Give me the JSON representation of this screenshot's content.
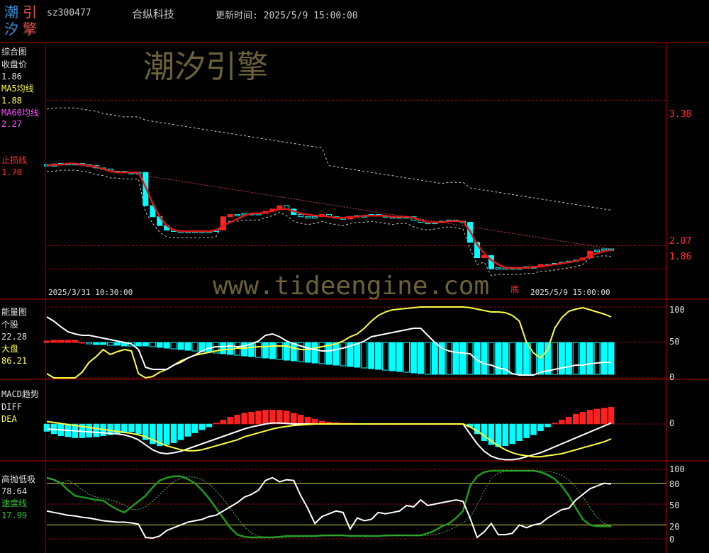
{
  "header": {
    "logo_chars": [
      "潮",
      "引",
      "汐",
      "擎"
    ],
    "code": "sz300477",
    "name": "合纵科技",
    "update_label": "更新时间: 2025/5/9 15:00:00"
  },
  "watermark": {
    "brand": "潮汐引擎",
    "url": "www.tideengine.com"
  },
  "panel1": {
    "title": "综合图",
    "close_label": "收盘价",
    "close_value": "1.86",
    "ma5_label": "MA5均线",
    "ma5_value": "1.88",
    "ma60_label": "MA60均线",
    "ma60_value": "2.27",
    "stop_label": "止损线",
    "stop_value": "1.70",
    "right_ticks": [
      "3.38",
      "2.07",
      "1.86"
    ],
    "date_start": "2025/3/31 10:30:00",
    "date_end": "2025/5/9 15:00:00",
    "marker_di": "底"
  },
  "panel2": {
    "title": "能量图",
    "stock_label": "个股",
    "stock_value": "22.28",
    "market_label": "大盘",
    "market_value": "86.21",
    "ticks": [
      "100",
      "50",
      "0"
    ]
  },
  "panel3": {
    "title": "MACD趋势",
    "diff_label": "DIFF",
    "dea_label": "DEA",
    "ticks": [
      "0"
    ]
  },
  "panel4": {
    "title": "高抛低吸",
    "value1": "78.64",
    "speed_label": "速度线",
    "speed_value": "17.99",
    "ticks": [
      "100",
      "80",
      "50",
      "20",
      "0"
    ]
  },
  "colors": {
    "up": "#ff2020",
    "down": "#00ffff",
    "ma5": "#ffff40",
    "ma60": "#e8e8e8",
    "red_line": "#e01818",
    "grid": "#b00000"
  },
  "chart_data": [
    {
      "type": "candlestick",
      "title": "综合图",
      "x_range": [
        "2025/3/31 10:30:00",
        "2025/5/9 15:00:00"
      ],
      "ylim": [
        1.6,
        3.9
      ],
      "ref_levels": [
        3.38,
        2.07,
        1.86
      ],
      "close": [
        2.8,
        2.8,
        2.81,
        2.81,
        2.81,
        2.8,
        2.79,
        2.77,
        2.76,
        2.74,
        2.74,
        2.73,
        2.73,
        2.73,
        2.43,
        2.33,
        2.25,
        2.21,
        2.2,
        2.2,
        2.2,
        2.2,
        2.2,
        2.2,
        2.21,
        2.33,
        2.35,
        2.35,
        2.36,
        2.36,
        2.36,
        2.38,
        2.4,
        2.43,
        2.4,
        2.35,
        2.33,
        2.32,
        2.33,
        2.35,
        2.33,
        2.32,
        2.31,
        2.33,
        2.34,
        2.34,
        2.35,
        2.34,
        2.33,
        2.32,
        2.33,
        2.33,
        2.3,
        2.28,
        2.27,
        2.28,
        2.29,
        2.3,
        2.29,
        2.28,
        2.1,
        1.96,
        1.98,
        1.86,
        1.87,
        1.87,
        1.87,
        1.87,
        1.88,
        1.88,
        1.9,
        1.9,
        1.91,
        1.92,
        1.93,
        1.94,
        1.96,
        2.02,
        2.03,
        2.04,
        2.03
      ],
      "series": [
        {
          "name": "MA5均线",
          "values": [
            2.79,
            2.8,
            2.8,
            2.81,
            2.81,
            2.8,
            2.79,
            2.78,
            2.76,
            2.74,
            2.73,
            2.73,
            2.73,
            2.73,
            2.6,
            2.45,
            2.33,
            2.25,
            2.21,
            2.2,
            2.2,
            2.2,
            2.2,
            2.2,
            2.21,
            2.25,
            2.28,
            2.31,
            2.34,
            2.36,
            2.36,
            2.37,
            2.38,
            2.4,
            2.4,
            2.38,
            2.36,
            2.35,
            2.34,
            2.34,
            2.33,
            2.32,
            2.32,
            2.33,
            2.33,
            2.34,
            2.34,
            2.34,
            2.34,
            2.33,
            2.33,
            2.33,
            2.32,
            2.3,
            2.28,
            2.28,
            2.28,
            2.29,
            2.29,
            2.29,
            2.2,
            2.08,
            2.0,
            1.94,
            1.9,
            1.87,
            1.87,
            1.87,
            1.87,
            1.88,
            1.88,
            1.89,
            1.9,
            1.91,
            1.92,
            1.93,
            1.95,
            1.98,
            2.0,
            2.02,
            2.03
          ]
        },
        {
          "name": "MA60均线",
          "values": [
            2.8,
            2.81,
            2.81,
            2.8,
            2.8,
            2.79,
            2.78,
            2.77,
            2.76,
            2.75,
            2.74,
            2.73,
            2.72,
            2.71,
            2.7,
            2.69,
            2.68,
            2.67,
            2.66,
            2.65,
            2.64,
            2.63,
            2.62,
            2.61,
            2.6,
            2.59,
            2.58,
            2.57,
            2.56,
            2.55,
            2.54,
            2.53,
            2.52,
            2.51,
            2.5,
            2.49,
            2.48,
            2.47,
            2.46,
            2.45,
            2.44,
            2.43,
            2.42,
            2.41,
            2.4,
            2.39,
            2.38,
            2.37,
            2.36,
            2.35,
            2.34,
            2.33,
            2.32,
            2.31,
            2.3,
            2.29,
            2.28,
            2.27,
            2.26,
            2.25,
            2.24,
            2.23,
            2.22,
            2.21,
            2.2,
            2.19,
            2.18,
            2.17,
            2.16,
            2.15,
            2.14,
            2.13,
            2.12,
            2.11,
            2.1,
            2.09,
            2.08,
            2.07,
            2.06,
            2.05,
            2.04
          ]
        }
      ]
    },
    {
      "type": "bar",
      "title": "能量图",
      "ylim": [
        0,
        100
      ],
      "series": [
        {
          "name": "个股",
          "values": [
            6,
            0,
            0,
            0,
            0,
            8,
            22,
            30,
            40,
            33,
            37,
            40,
            38,
            6,
            0,
            2,
            8,
            12,
            18,
            24,
            28,
            32,
            34,
            36,
            38,
            40,
            40,
            42,
            42,
            43,
            44,
            44,
            45,
            45,
            45,
            42,
            40,
            40,
            42,
            44,
            46,
            48,
            52,
            58,
            62,
            70,
            80,
            88,
            93,
            96,
            97,
            98,
            99,
            100,
            100,
            100,
            100,
            100,
            100,
            100,
            99,
            97,
            95,
            93,
            93,
            92,
            88,
            80,
            50,
            35,
            28,
            40,
            70,
            85,
            94,
            97,
            99,
            96,
            93,
            90,
            86
          ]
        },
        {
          "name": "大盘",
          "values": [
            86,
            80,
            72,
            65,
            62,
            60,
            60,
            58,
            56,
            54,
            52,
            50,
            48,
            40,
            15,
            12,
            12,
            12,
            18,
            22,
            28,
            32,
            38,
            42,
            44,
            44,
            45,
            44,
            45,
            48,
            52,
            60,
            62,
            58,
            52,
            48,
            45,
            42,
            40,
            38,
            38,
            40,
            42,
            45,
            48,
            52,
            58,
            60,
            62,
            64,
            66,
            68,
            70,
            70,
            60,
            50,
            42,
            38,
            36,
            35,
            34,
            25,
            20,
            18,
            14,
            12,
            6,
            4,
            4,
            4,
            8,
            10,
            12,
            14,
            16,
            18,
            18,
            20,
            21,
            22,
            22
          ]
        }
      ],
      "bars": [
        2,
        3,
        3,
        3,
        3,
        0,
        -2,
        -3,
        -3,
        -4,
        -4,
        -5,
        -5,
        -5,
        -5,
        -6,
        -7,
        -8,
        -9,
        -10,
        -11,
        -12,
        -13,
        -14,
        -15,
        -16,
        -17,
        -18,
        -19,
        -20,
        -21,
        -22,
        -23,
        -24,
        -25,
        -26,
        -27,
        -28,
        -29,
        -30,
        -31,
        -32,
        -33,
        -34,
        -35,
        -36,
        -37,
        -38,
        -39,
        -40,
        -41,
        -42,
        -43,
        -44,
        -45,
        -45,
        -45,
        -45,
        -45,
        -45,
        -45,
        -45,
        -45,
        -45,
        -45,
        -45,
        -45,
        -45,
        -45,
        -45,
        -45,
        -45,
        -45,
        -45,
        -45,
        -45,
        -45,
        -45,
        -45,
        -45,
        -45
      ]
    },
    {
      "type": "bar",
      "title": "MACD趋势",
      "series": [
        {
          "name": "DIFF",
          "values": [
            -0.1,
            -0.11,
            -0.12,
            -0.13,
            -0.14,
            -0.15,
            -0.16,
            -0.17,
            -0.18,
            -0.19,
            -0.2,
            -0.22,
            -0.26,
            -0.32,
            -0.42,
            -0.52,
            -0.58,
            -0.6,
            -0.58,
            -0.55,
            -0.5,
            -0.45,
            -0.4,
            -0.35,
            -0.3,
            -0.25,
            -0.2,
            -0.15,
            -0.1,
            -0.06,
            -0.03,
            0,
            0.02,
            0.02,
            0.01,
            0,
            0,
            0,
            0,
            0,
            0,
            0,
            0,
            0,
            0,
            0,
            0,
            0,
            0,
            0,
            0,
            0,
            0,
            0,
            0,
            0,
            0,
            0,
            0,
            0,
            -0.2,
            -0.4,
            -0.55,
            -0.65,
            -0.7,
            -0.72,
            -0.72,
            -0.7,
            -0.66,
            -0.62,
            -0.58,
            -0.52,
            -0.46,
            -0.4,
            -0.34,
            -0.28,
            -0.22,
            -0.16,
            -0.1,
            -0.04,
            0.02
          ]
        },
        {
          "name": "DEA",
          "values": [
            0.05,
            0.03,
            0.01,
            -0.01,
            -0.03,
            -0.05,
            -0.07,
            -0.09,
            -0.11,
            -0.13,
            -0.15,
            -0.17,
            -0.19,
            -0.22,
            -0.26,
            -0.32,
            -0.38,
            -0.44,
            -0.48,
            -0.52,
            -0.54,
            -0.54,
            -0.52,
            -0.48,
            -0.44,
            -0.4,
            -0.36,
            -0.32,
            -0.26,
            -0.22,
            -0.18,
            -0.14,
            -0.1,
            -0.07,
            -0.05,
            -0.03,
            -0.02,
            -0.01,
            0,
            0,
            0,
            0,
            0,
            0,
            0,
            0,
            0,
            0,
            0,
            0,
            0,
            0,
            0,
            0,
            0,
            0,
            0,
            0,
            0,
            0,
            -0.06,
            -0.14,
            -0.24,
            -0.34,
            -0.44,
            -0.52,
            -0.58,
            -0.62,
            -0.64,
            -0.66,
            -0.66,
            -0.64,
            -0.62,
            -0.6,
            -0.56,
            -0.52,
            -0.48,
            -0.44,
            -0.4,
            -0.36,
            -0.3
          ]
        }
      ],
      "bars": [
        -0.15,
        -0.2,
        -0.24,
        -0.26,
        -0.28,
        -0.28,
        -0.27,
        -0.26,
        -0.24,
        -0.22,
        -0.2,
        -0.18,
        -0.16,
        -0.2,
        -0.32,
        -0.4,
        -0.44,
        -0.42,
        -0.38,
        -0.32,
        -0.25,
        -0.18,
        -0.12,
        -0.06,
        0.02,
        0.08,
        0.14,
        0.18,
        0.22,
        0.24,
        0.26,
        0.28,
        0.28,
        0.28,
        0.26,
        0.22,
        0.18,
        0.14,
        0.1,
        0.06,
        0.04,
        0.03,
        0.02,
        0.02,
        0.01,
        0.01,
        0,
        0,
        0,
        0,
        0,
        0,
        0,
        0,
        0,
        0,
        0,
        0,
        0,
        0,
        -0.06,
        -0.2,
        -0.34,
        -0.42,
        -0.46,
        -0.44,
        -0.4,
        -0.34,
        -0.28,
        -0.22,
        -0.14,
        -0.06,
        0.02,
        0.08,
        0.14,
        0.2,
        0.24,
        0.28,
        0.3,
        0.32,
        0.34
      ]
    },
    {
      "type": "line",
      "title": "高抛低吸",
      "ylim": [
        0,
        100
      ],
      "ref_levels": [
        100,
        80,
        50,
        20,
        0
      ],
      "series": [
        {
          "name": "",
          "values": [
            40,
            38,
            36,
            34,
            33,
            31,
            30,
            28,
            26,
            25,
            24,
            24,
            23,
            21,
            2,
            1,
            4,
            12,
            16,
            20,
            24,
            26,
            28,
            32,
            34,
            40,
            46,
            52,
            60,
            64,
            70,
            84,
            88,
            82,
            85,
            84,
            62,
            44,
            22,
            32,
            36,
            40,
            38,
            14,
            30,
            26,
            28,
            38,
            36,
            38,
            40,
            48,
            46,
            56,
            48,
            50,
            52,
            54,
            56,
            54,
            30,
            2,
            10,
            22,
            6,
            6,
            8,
            20,
            16,
            20,
            22,
            30,
            36,
            42,
            44,
            56,
            64,
            72,
            76,
            80,
            79
          ]
        },
        {
          "name": "速度线",
          "values": [
            88,
            85,
            80,
            70,
            62,
            60,
            58,
            56,
            55,
            48,
            42,
            38,
            46,
            54,
            62,
            74,
            84,
            88,
            90,
            90,
            86,
            80,
            70,
            58,
            44,
            30,
            16,
            6,
            3,
            2,
            2,
            2,
            2,
            3,
            4,
            4,
            4,
            4,
            4,
            5,
            5,
            5,
            5,
            4,
            4,
            4,
            4,
            4,
            5,
            5,
            5,
            5,
            5,
            5,
            8,
            12,
            18,
            22,
            30,
            40,
            76,
            90,
            96,
            98,
            98,
            98,
            98,
            98,
            98,
            98,
            96,
            92,
            86,
            76,
            62,
            44,
            28,
            20,
            18,
            18,
            18
          ]
        }
      ]
    }
  ]
}
